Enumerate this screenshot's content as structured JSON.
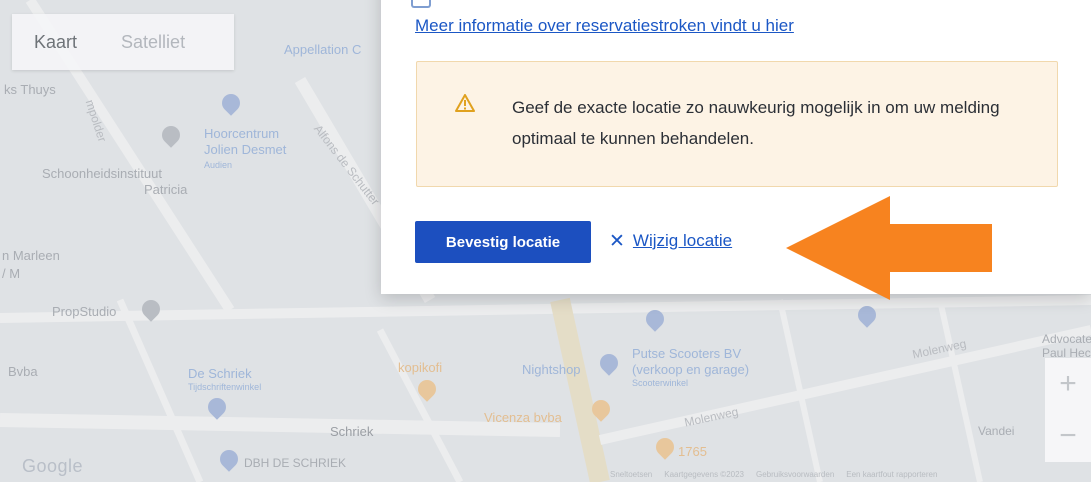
{
  "map": {
    "map_types": [
      "Kaart",
      "Satelliet"
    ],
    "active_map_type": "Kaart",
    "labels": [
      "Appellation C",
      "ks Thuys",
      "mpolder",
      "Hoorcentrum",
      "Jolien Desmet",
      "Audien",
      "Schoonheidsinstituut",
      "Patricia",
      "Alfons de Schutter",
      "n Marleen",
      "/ M",
      "PropStudio",
      "Bvba",
      "De Schriek",
      "Tijdschriftenwinkel",
      "kopikofi",
      "Nightshop",
      "Putse Scooters BV",
      "(verkoop en garage)",
      "Scooterwinkel",
      "Vicenza bvba",
      "Molenweg",
      "Molenweg",
      "1765",
      "Schriek",
      "DBH DE SCHRIEK",
      "Advocaten",
      "Paul Hect",
      "Vandei"
    ],
    "zoom_in": "+",
    "zoom_out": "−",
    "logo": "Google",
    "attribution": [
      "Sneltoetsen",
      "Kaartgegevens ©2023",
      "Gebruiksvoorwaarden",
      "Een kaartfout rapporteren"
    ]
  },
  "dialog": {
    "info_link": "Meer informatie over reservatiestroken vindt u hier",
    "warning_icon": "warning-triangle-icon",
    "warning_text": "Geef de exacte locatie zo nauwkeurig mogelijk in om uw melding optimaal te kunnen behandelen.",
    "confirm_button": "Bevestig locatie",
    "change_icon": "close-icon",
    "change_link": "Wijzig locatie"
  },
  "annotation": {
    "arrow_icon": "arrow-left-icon",
    "color": "#f7831f"
  },
  "colors": {
    "primary": "#1c4fbf",
    "link": "#1b57c5",
    "warning_bg": "#fdf3e5",
    "warning_border": "#f1d8ad",
    "warning_icon": "#e0a11f"
  }
}
